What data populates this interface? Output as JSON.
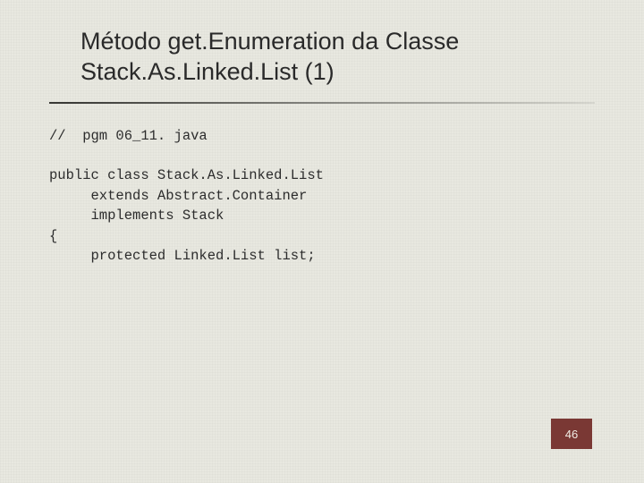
{
  "title_line1": "Método get.Enumeration da Classe",
  "title_line2": "Stack.As.Linked.List (1)",
  "code": {
    "l1": "//  pgm 06_11. java",
    "l2": "",
    "l3": "public class Stack.As.Linked.List",
    "l4": "     extends Abstract.Container",
    "l5": "     implements Stack",
    "l6": "{",
    "l7": "     protected Linked.List list;"
  },
  "page_number": "46"
}
